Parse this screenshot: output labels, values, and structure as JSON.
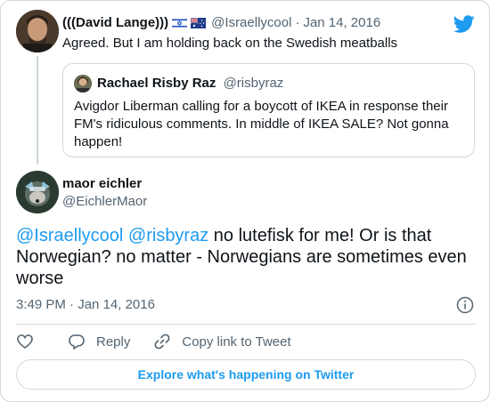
{
  "parent_tweet": {
    "author_name": "(((David Lange)))",
    "flags": [
      "israel-flag",
      "australia-flag"
    ],
    "handle": "@Israellycool",
    "separator": "·",
    "date": "Jan 14, 2016",
    "text": "Agreed. But I am holding back on the Swedish meatballs"
  },
  "quoted_tweet": {
    "author_name": "Rachael Risby Raz",
    "handle": "@risbyraz",
    "text": "Avigdor Liberman calling for a boycott of IKEA in response their FM's ridiculous comments. In middle of  IKEA SALE? Not gonna happen!"
  },
  "main_tweet": {
    "author_name": "maor eichler",
    "handle": "@EichlerMaor",
    "mention_1": "@Israellycool",
    "mention_2": "@risbyraz",
    "text_rest": " no lutefisk for me! Or is that Norwegian? no matter - Norwegians are sometimes even worse",
    "time": "3:49 PM",
    "separator": "·",
    "date": "Jan 14, 2016"
  },
  "actions": {
    "reply_label": "Reply",
    "copy_link_label": "Copy link to Tweet"
  },
  "explore_button_label": "Explore what's happening on Twitter",
  "colors": {
    "accent": "#1d9bf0",
    "text": "#0f1419",
    "secondary": "#536471",
    "border": "#cfd9de"
  },
  "icons": [
    "twitter-bird-icon",
    "info-icon",
    "heart-icon",
    "reply-icon",
    "link-icon"
  ]
}
